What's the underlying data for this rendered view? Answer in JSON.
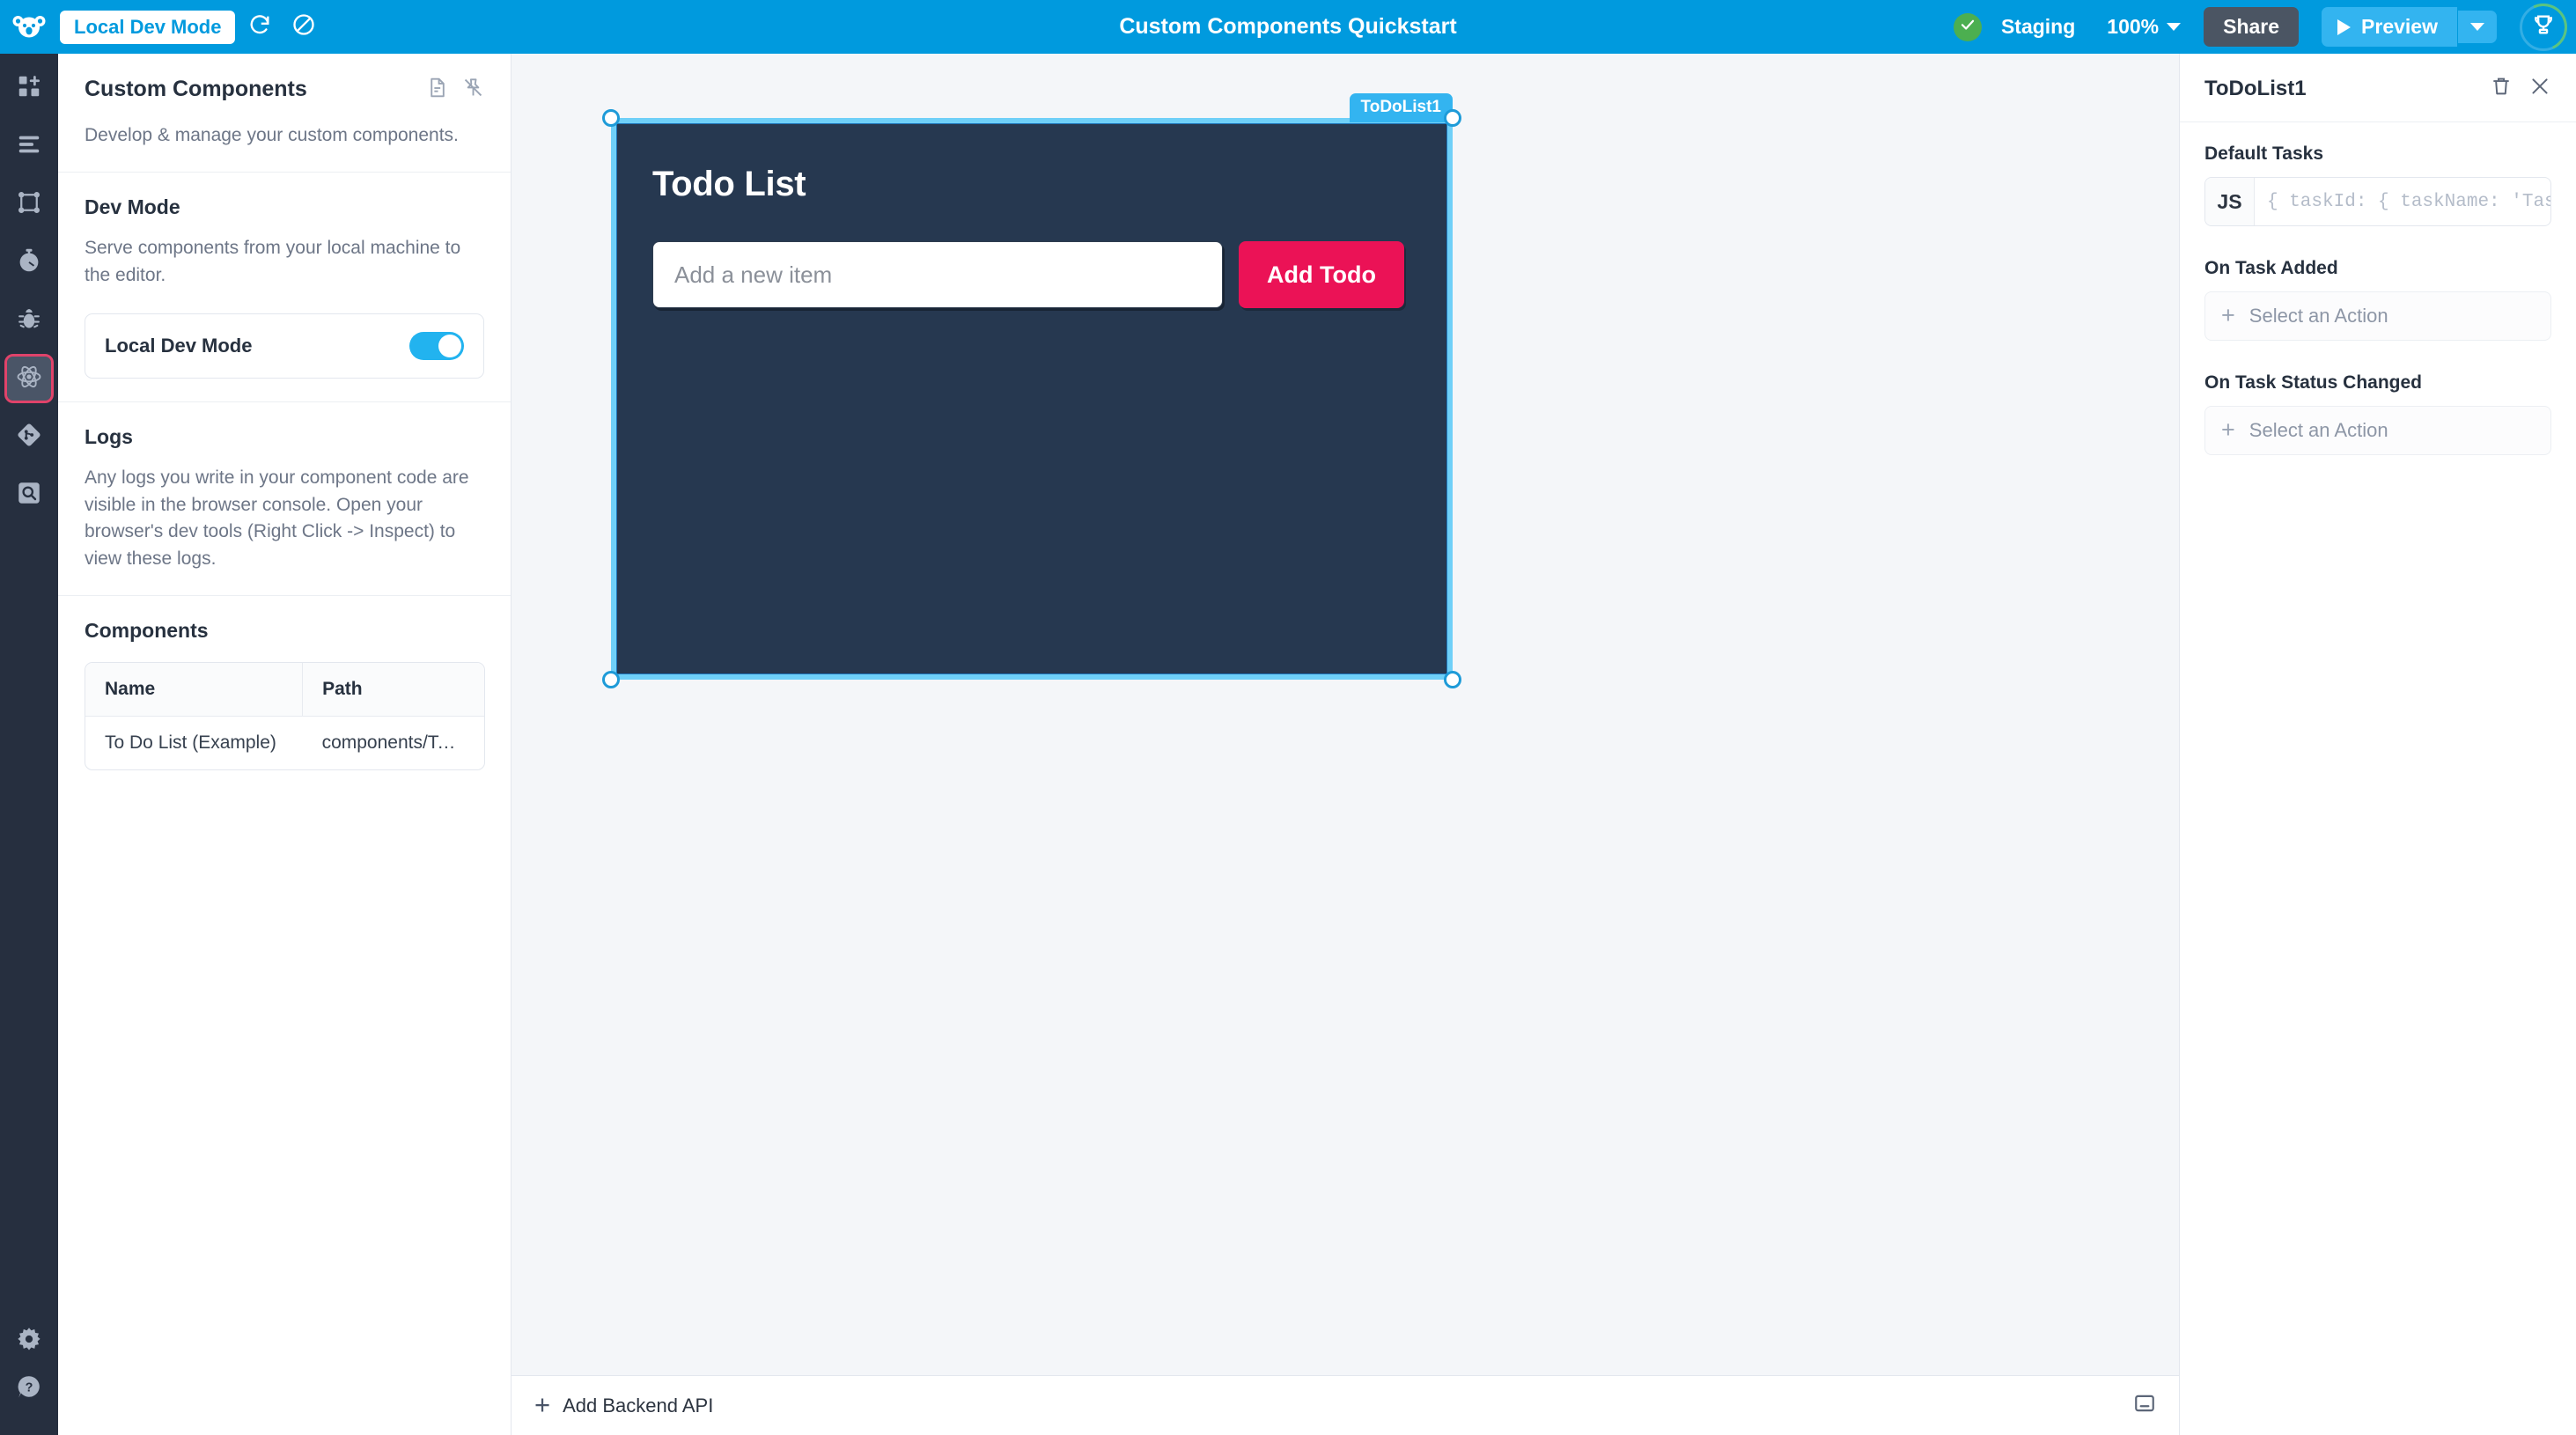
{
  "topbar": {
    "logo_icon": "koala-logo-icon",
    "local_dev_chip": "Local Dev Mode",
    "refresh_icon": "refresh-icon",
    "disable_icon": "block-icon",
    "app_title": "Custom Components Quickstart",
    "status_icon": "check-circle-icon",
    "environment": "Staging",
    "zoom_level": "100%",
    "share_label": "Share",
    "preview_label": "Preview",
    "trophy_icon": "trophy-icon"
  },
  "rail": {
    "items": [
      {
        "name": "add-component",
        "icon": "add-squares-icon"
      },
      {
        "name": "page-list",
        "icon": "list-icon"
      },
      {
        "name": "workflows",
        "icon": "nodes-graph-icon"
      },
      {
        "name": "performance",
        "icon": "stopwatch-icon"
      },
      {
        "name": "debugger",
        "icon": "bug-icon"
      },
      {
        "name": "custom-components",
        "icon": "react-atom-icon",
        "active": true
      },
      {
        "name": "source-control",
        "icon": "git-branch-icon"
      },
      {
        "name": "inspect",
        "icon": "magnifier-box-icon"
      }
    ],
    "bottom": [
      {
        "name": "settings",
        "icon": "gear-icon"
      },
      {
        "name": "help",
        "icon": "question-bubble-icon"
      }
    ]
  },
  "panel": {
    "title": "Custom Components",
    "doc_icon": "document-icon",
    "unpin_icon": "unpin-icon",
    "description": "Develop & manage your custom components.",
    "dev_mode": {
      "heading": "Dev Mode",
      "description": "Serve components from your local machine to the editor.",
      "toggle_label": "Local Dev Mode",
      "toggle_on": true
    },
    "logs": {
      "heading": "Logs",
      "description": "Any logs you write in your component code are visible in the browser console. Open your browser's dev tools (Right Click -> Inspect) to view these logs."
    },
    "components": {
      "heading": "Components",
      "columns": [
        "Name",
        "Path"
      ],
      "rows": [
        {
          "name": "To Do List (Example)",
          "path": "components/ToDo…"
        }
      ]
    }
  },
  "canvas": {
    "selection_tag": "ToDoList1",
    "widget": {
      "title": "Todo List",
      "input_placeholder": "Add a new item",
      "button_label": "Add Todo"
    },
    "bottom_bar": {
      "add_api_label": "Add Backend API",
      "minimize_icon": "minimize-panel-icon"
    }
  },
  "right_panel": {
    "title": "ToDoList1",
    "delete_icon": "trash-icon",
    "close_icon": "close-icon",
    "fields": [
      {
        "label": "Default Tasks",
        "kind": "code",
        "badge": "JS",
        "placeholder": "{ taskId: { taskName: 'Task"
      },
      {
        "label": "On Task Added",
        "kind": "action",
        "placeholder": "Select an Action"
      },
      {
        "label": "On Task Status Changed",
        "kind": "action",
        "placeholder": "Select an Action"
      }
    ]
  },
  "colors": {
    "brand_blue": "#009ade",
    "accent_pink": "#eb1256",
    "widget_bg": "#263850",
    "selection_blue": "#33b4f0",
    "rail_bg": "#262f3f",
    "toggle_on": "#22b3ef",
    "status_green": "#4caf50"
  }
}
